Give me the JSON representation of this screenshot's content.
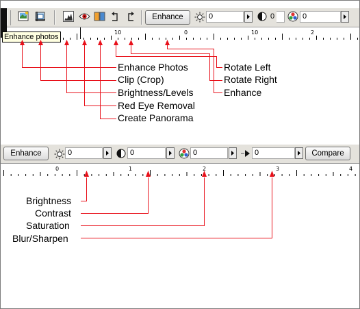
{
  "toolbar1": {
    "tooltip": "Enhance photos",
    "enhance_label": "Enhance",
    "brightness_value": "0",
    "contrast_value": "0",
    "saturation_value": "0",
    "ruler_numbers": [
      "10",
      "0",
      "10",
      "2"
    ]
  },
  "callouts_top": {
    "enhance_photos": "Enhance Photos",
    "clip_crop": "Clip (Crop)",
    "brightness_levels": "Brightness/Levels",
    "red_eye_removal": "Red Eye Removal",
    "create_panorama": "Create Panorama",
    "rotate_left": "Rotate Left",
    "rotate_right": "Rotate Right",
    "enhance": "Enhance"
  },
  "toolbar2": {
    "enhance_label": "Enhance",
    "brightness_value": "0",
    "contrast_value": "0",
    "saturation_value": "0",
    "blur_value": "0",
    "compare_label": "Compare",
    "ruler_numbers": [
      "0",
      "1",
      "2",
      "3",
      "4"
    ]
  },
  "callouts_bottom": {
    "brightness": "Brightness",
    "contrast": "Contrast",
    "saturation": "Saturation",
    "blur_sharpen": "Blur/Sharpen"
  },
  "colors": {
    "arrow_red": "#e8101a",
    "toolbar_bg": "#e4e2dc"
  },
  "icons": [
    "enhance-photos-icon",
    "clip-crop-icon",
    "brightness-levels-icon",
    "red-eye-icon",
    "create-panorama-icon",
    "rotate-left-icon",
    "rotate-right-icon",
    "brightness-sun-icon",
    "contrast-icon",
    "saturation-icon",
    "blur-sharpen-icon"
  ]
}
